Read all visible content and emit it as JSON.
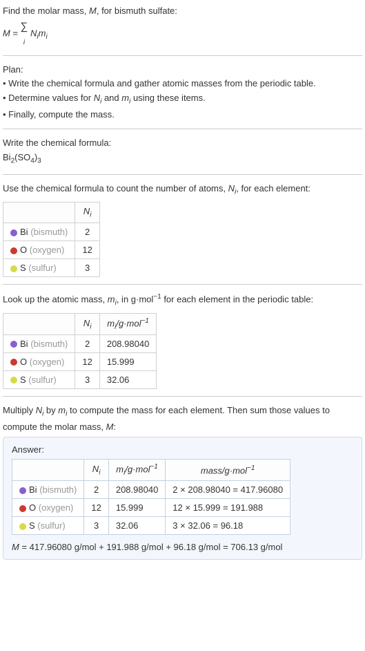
{
  "intro": {
    "prompt_pre": "Find the molar mass, ",
    "prompt_var": "M",
    "prompt_post": ", for bismuth sulfate:",
    "eq_lhs": "M",
    "eq_eq": " = ",
    "eq_sum": "∑",
    "eq_sub": "i",
    "eq_rhs_pre": " N",
    "eq_rhs_mid": "m"
  },
  "plan": {
    "header": "Plan:",
    "line1": "• Write the chemical formula and gather atomic masses from the periodic table.",
    "line2_pre": "• Determine values for ",
    "line2_n": "N",
    "line2_and": " and ",
    "line2_m": "m",
    "line2_post": " using these items.",
    "line3": "• Finally, compute the mass."
  },
  "formula_step": {
    "header": "Write the chemical formula:",
    "bi": "Bi",
    "bi_n": "2",
    "so": "(SO",
    "so_sub": "4",
    "close": ")",
    "outer": "3"
  },
  "count_step": {
    "header_pre": "Use the chemical formula to count the number of atoms, ",
    "header_n": "N",
    "header_post": ", for each element:",
    "col_n": "N",
    "col_i": "i"
  },
  "mass_step": {
    "header_pre": "Look up the atomic mass, ",
    "header_m": "m",
    "header_mid": ", in g·mol",
    "header_exp": "−1",
    "header_post": " for each element in the periodic table:",
    "col_m": "m",
    "col_unit_pre": "/g·mol",
    "col_unit_exp": "−1"
  },
  "mult_step": {
    "line_pre": "Multiply ",
    "line_n": "N",
    "line_by": " by ",
    "line_m": "m",
    "line_mid": " to compute the mass for each element. Then sum those values to compute the molar mass, ",
    "line_var": "M",
    "line_post": ":"
  },
  "answer": {
    "label": "Answer:",
    "mass_col_pre": "mass/g·mol",
    "mass_col_exp": "−1",
    "final_pre": "M",
    "final_eq": " = 417.96080 g/mol + 191.988 g/mol + 96.18 g/mol = 706.13 g/mol"
  },
  "elements": [
    {
      "color": "#8a5fcf",
      "sym": "Bi",
      "name": "(bismuth)",
      "n": "2",
      "m": "208.98040",
      "mass": "2 × 208.98040 = 417.96080"
    },
    {
      "color": "#cc3a2f",
      "sym": "O",
      "name": "(oxygen)",
      "n": "12",
      "m": "15.999",
      "mass": "12 × 15.999 = 191.988"
    },
    {
      "color": "#d9d94a",
      "sym": "S",
      "name": "(sulfur)",
      "n": "3",
      "m": "32.06",
      "mass": "3 × 32.06 = 96.18"
    }
  ]
}
